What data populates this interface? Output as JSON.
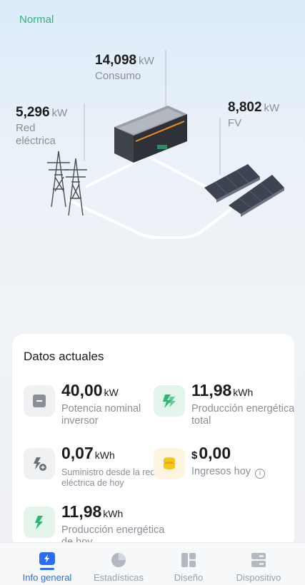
{
  "status": "Normal",
  "flow": {
    "consumo": {
      "value": "14,098",
      "unit": "kW",
      "label": "Consumo"
    },
    "red": {
      "value": "5,296",
      "unit": "kW",
      "label_line1": "Red",
      "label_line2": "eléctrica"
    },
    "fv": {
      "value": "8,802",
      "unit": "kW",
      "label": "FV"
    }
  },
  "card": {
    "title": "Datos actuales",
    "items": [
      {
        "value": "40,00",
        "unit": "kW",
        "label": "Potencia nominal inversor",
        "icon": "inverter-icon"
      },
      {
        "value": "11,98",
        "unit": "kWh",
        "label": "Producción energética total",
        "icon": "energy-total-icon"
      },
      {
        "value": "0,07",
        "unit": "kWh",
        "label": "Suministro desde la red eléctrica de hoy",
        "icon": "grid-supply-icon"
      },
      {
        "currency": "$",
        "value": "0,00",
        "label": "Ingresos hoy",
        "icon": "coins-icon"
      },
      {
        "value": "11,98",
        "unit": "kWh",
        "label": "Producción energética de hoy",
        "icon": "energy-today-icon"
      }
    ]
  },
  "tabs": [
    {
      "label": "Info general",
      "active": true
    },
    {
      "label": "Estadísticas",
      "active": false
    },
    {
      "label": "Diseño",
      "active": false
    },
    {
      "label": "Dispositivo",
      "active": false
    }
  ],
  "colors": {
    "accent": "#2a6df4",
    "status_ok": "#2bb673",
    "energy_green": "#2bb673",
    "coin_yellow": "#f5c518"
  }
}
